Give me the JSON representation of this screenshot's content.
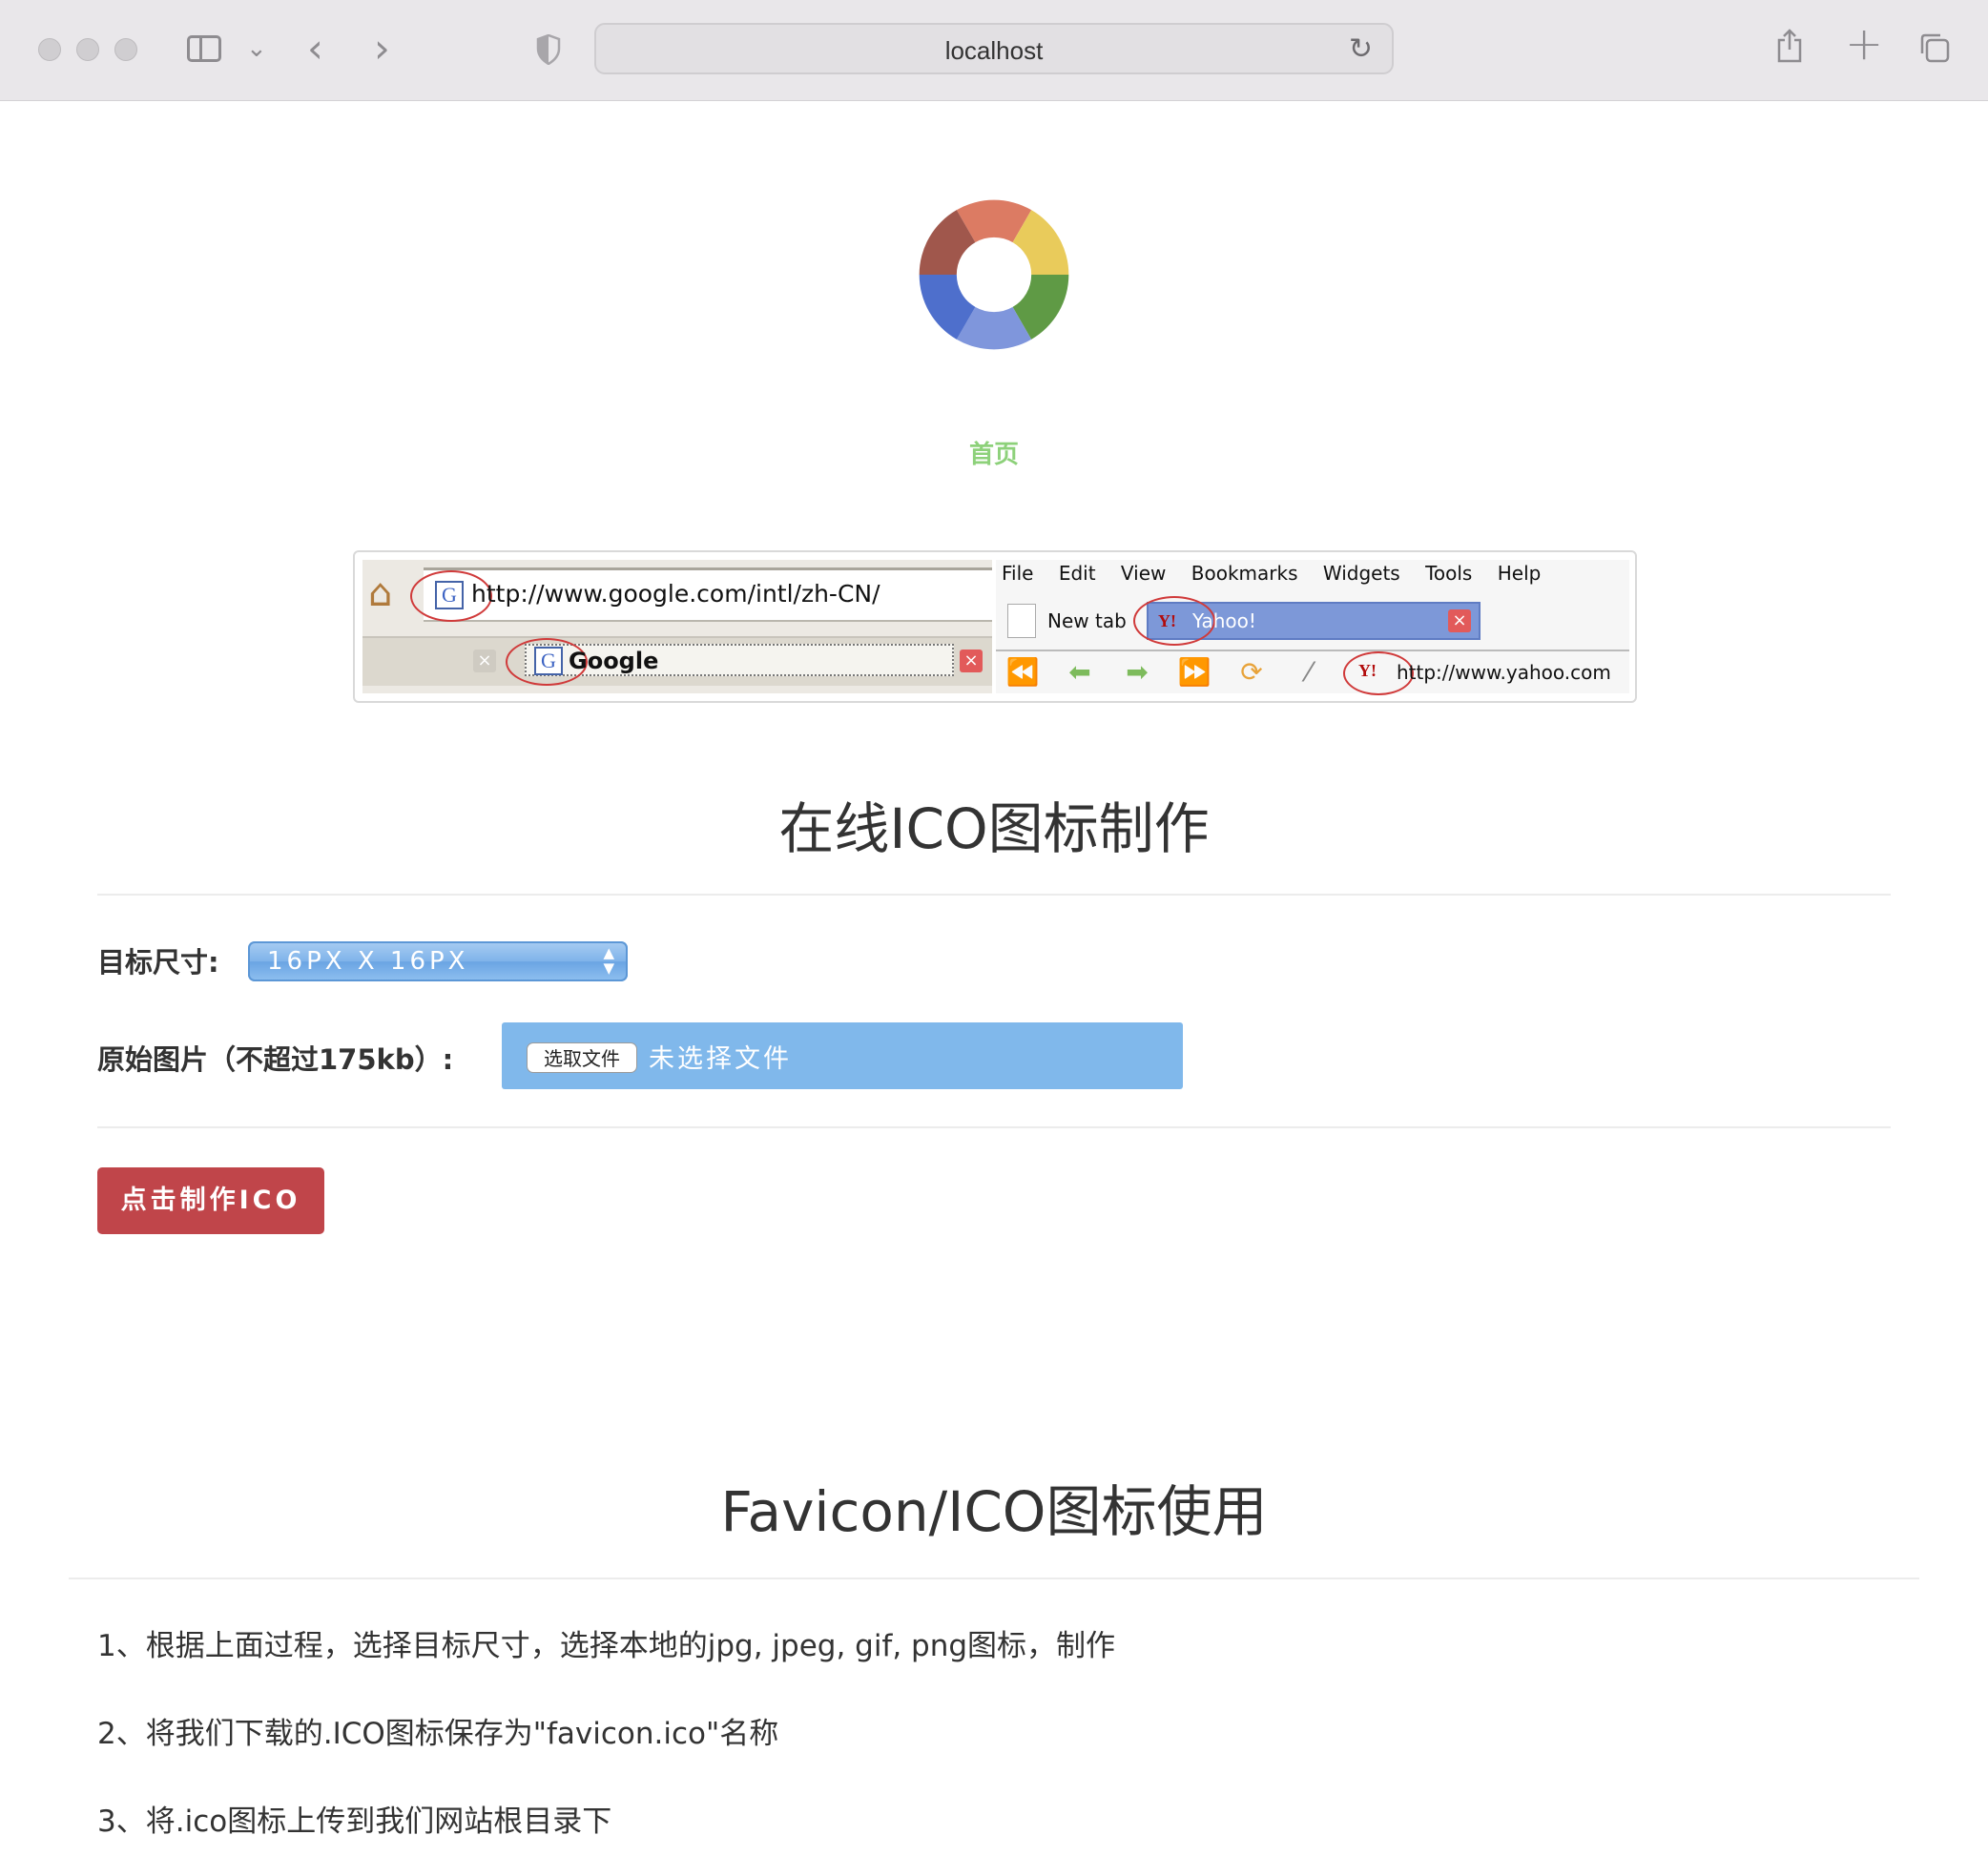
{
  "browser": {
    "url": "localhost",
    "icons": [
      "sidebar-icon",
      "chevron-down-icon",
      "back-icon",
      "forward-icon",
      "shield-icon",
      "reload-icon",
      "share-icon",
      "plus-icon",
      "tabs-icon"
    ]
  },
  "nav": {
    "home_label": "首页"
  },
  "banner": {
    "google_url": "http://www.google.com/intl/zh-CN/",
    "google_tab": "Google",
    "menu": [
      "File",
      "Edit",
      "View",
      "Bookmarks",
      "Widgets",
      "Tools",
      "Help"
    ],
    "new_tab": "New tab",
    "yahoo_tab": "Yahoo!",
    "yahoo_url": "http://www.yahoo.com"
  },
  "maker": {
    "title": "在线ICO图标制作",
    "size_label": "目标尺寸:",
    "size_value": "16PX  X  16PX",
    "image_label": "原始图片（不超过175kb）:",
    "file_button": "选取文件",
    "file_status": "未选择文件",
    "submit_label": "点击制作ICO"
  },
  "usage": {
    "title": "Favicon/ICO图标使用",
    "steps": [
      "1、根据上面过程，选择目标尺寸，选择本地的jpg, jpeg, gif, png图标，制作",
      "2、将我们下载的.ICO图标保存为\"favicon.ico\"名称",
      "3、将.ico图标上传到我们网站根目录下"
    ]
  },
  "colors": {
    "home_link": "#8dd17a",
    "submit_bg": "#c0454a",
    "file_box_bg": "#80b8eb",
    "logo": [
      "#dc7b63",
      "#e9cb5b",
      "#5f9a45",
      "#7f96dc",
      "#4e6fcc",
      "#a0574c"
    ]
  }
}
